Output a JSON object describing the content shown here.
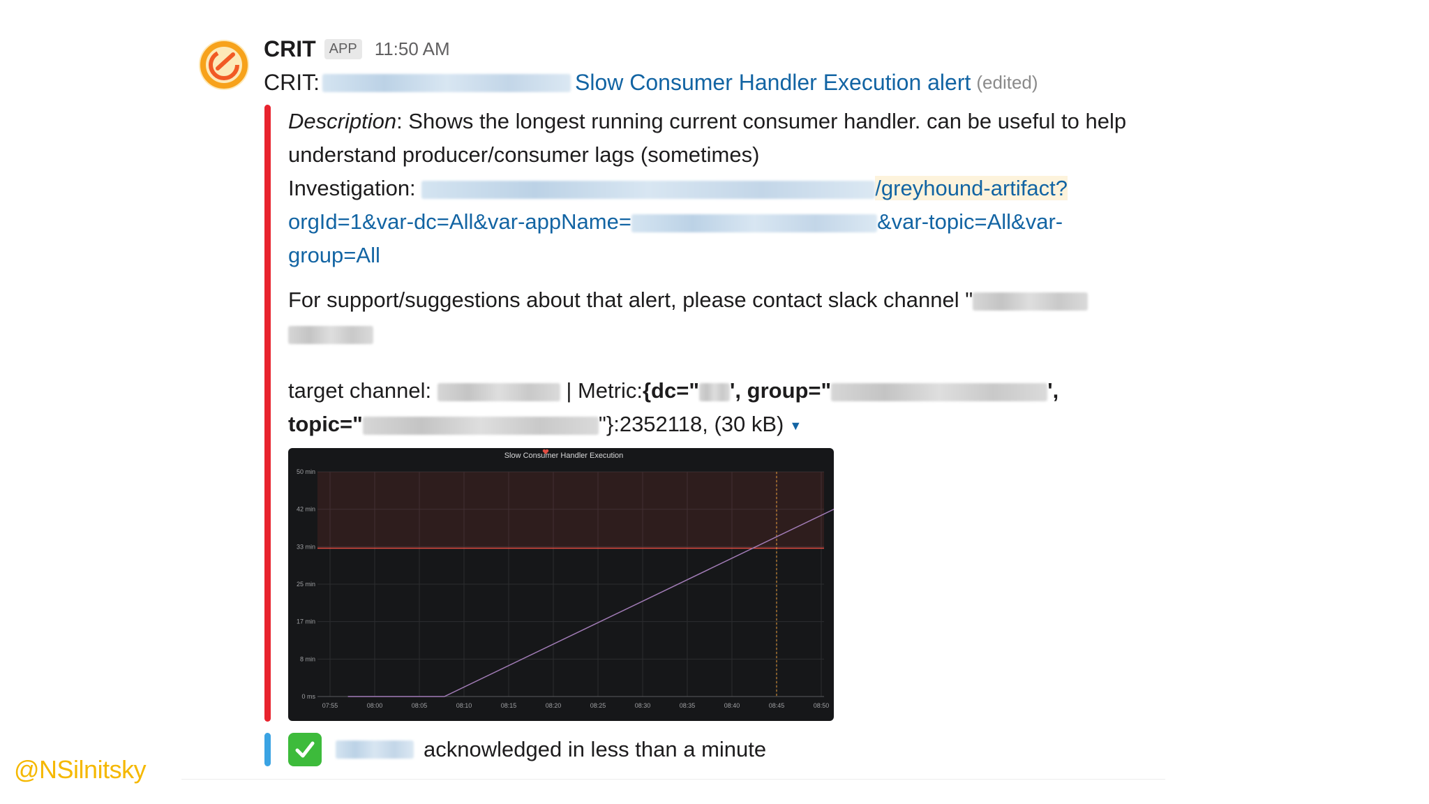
{
  "message": {
    "app_name": "CRIT",
    "app_badge": "APP",
    "time": "11:50 AM",
    "title_prefix": "CRIT:",
    "title_link": "Slow Consumer Handler Execution alert",
    "edited": "(edited)"
  },
  "attachment": {
    "description_label": "Description",
    "description_text": ": Shows the longest running current consumer handler. can be useful to help",
    "description_text_2": "understand producer/consumer lags (sometimes)",
    "investigation_label": "Investigation: ",
    "investigation_link_1": "/greyhound-artifact?",
    "investigation_link_2a": "orgId=1&var-dc=All&var-appName=",
    "investigation_link_2b": "&var-topic=All&var-",
    "investigation_link_3": "group=All",
    "support_text": "For support/suggestions about that alert, please contact slack channel \"",
    "target_label": "target channel: ",
    "metric_sep": " | Metric:",
    "metric_dc": "{dc=\"",
    "metric_group": "', group=\"",
    "metric_group_end": "',",
    "metric_topic": "topic=\"",
    "metric_value_tail": "\"}:2352118, (30 kB)",
    "caret": "▼"
  },
  "chart_data": {
    "type": "line",
    "title": "Slow Consumer Handler Execution",
    "x_ticks": [
      "07:55",
      "08:00",
      "08:05",
      "08:10",
      "08:15",
      "08:20",
      "08:25",
      "08:30",
      "08:35",
      "08:40",
      "08:45",
      "08:50"
    ],
    "y_ticks": [
      "50 min",
      "42 min",
      "33 min",
      "25 min",
      "17 min",
      "8 min",
      "0 ms"
    ],
    "ylim": [
      0,
      50
    ],
    "threshold": 33,
    "series": [
      {
        "values_minutes": [
          [
            7.95,
            0
          ],
          [
            8.13,
            0
          ],
          [
            8.88,
            43
          ],
          [
            8.9,
            43
          ]
        ]
      }
    ],
    "colors": {
      "background": "#161719",
      "line": "#a27cb7",
      "threshold": "#e24d42",
      "alert_marker": "#f2a33a"
    }
  },
  "ack": {
    "text": "acknowledged in less than a minute"
  },
  "footer": {
    "twitter_handle": "@NSilnitsky"
  }
}
